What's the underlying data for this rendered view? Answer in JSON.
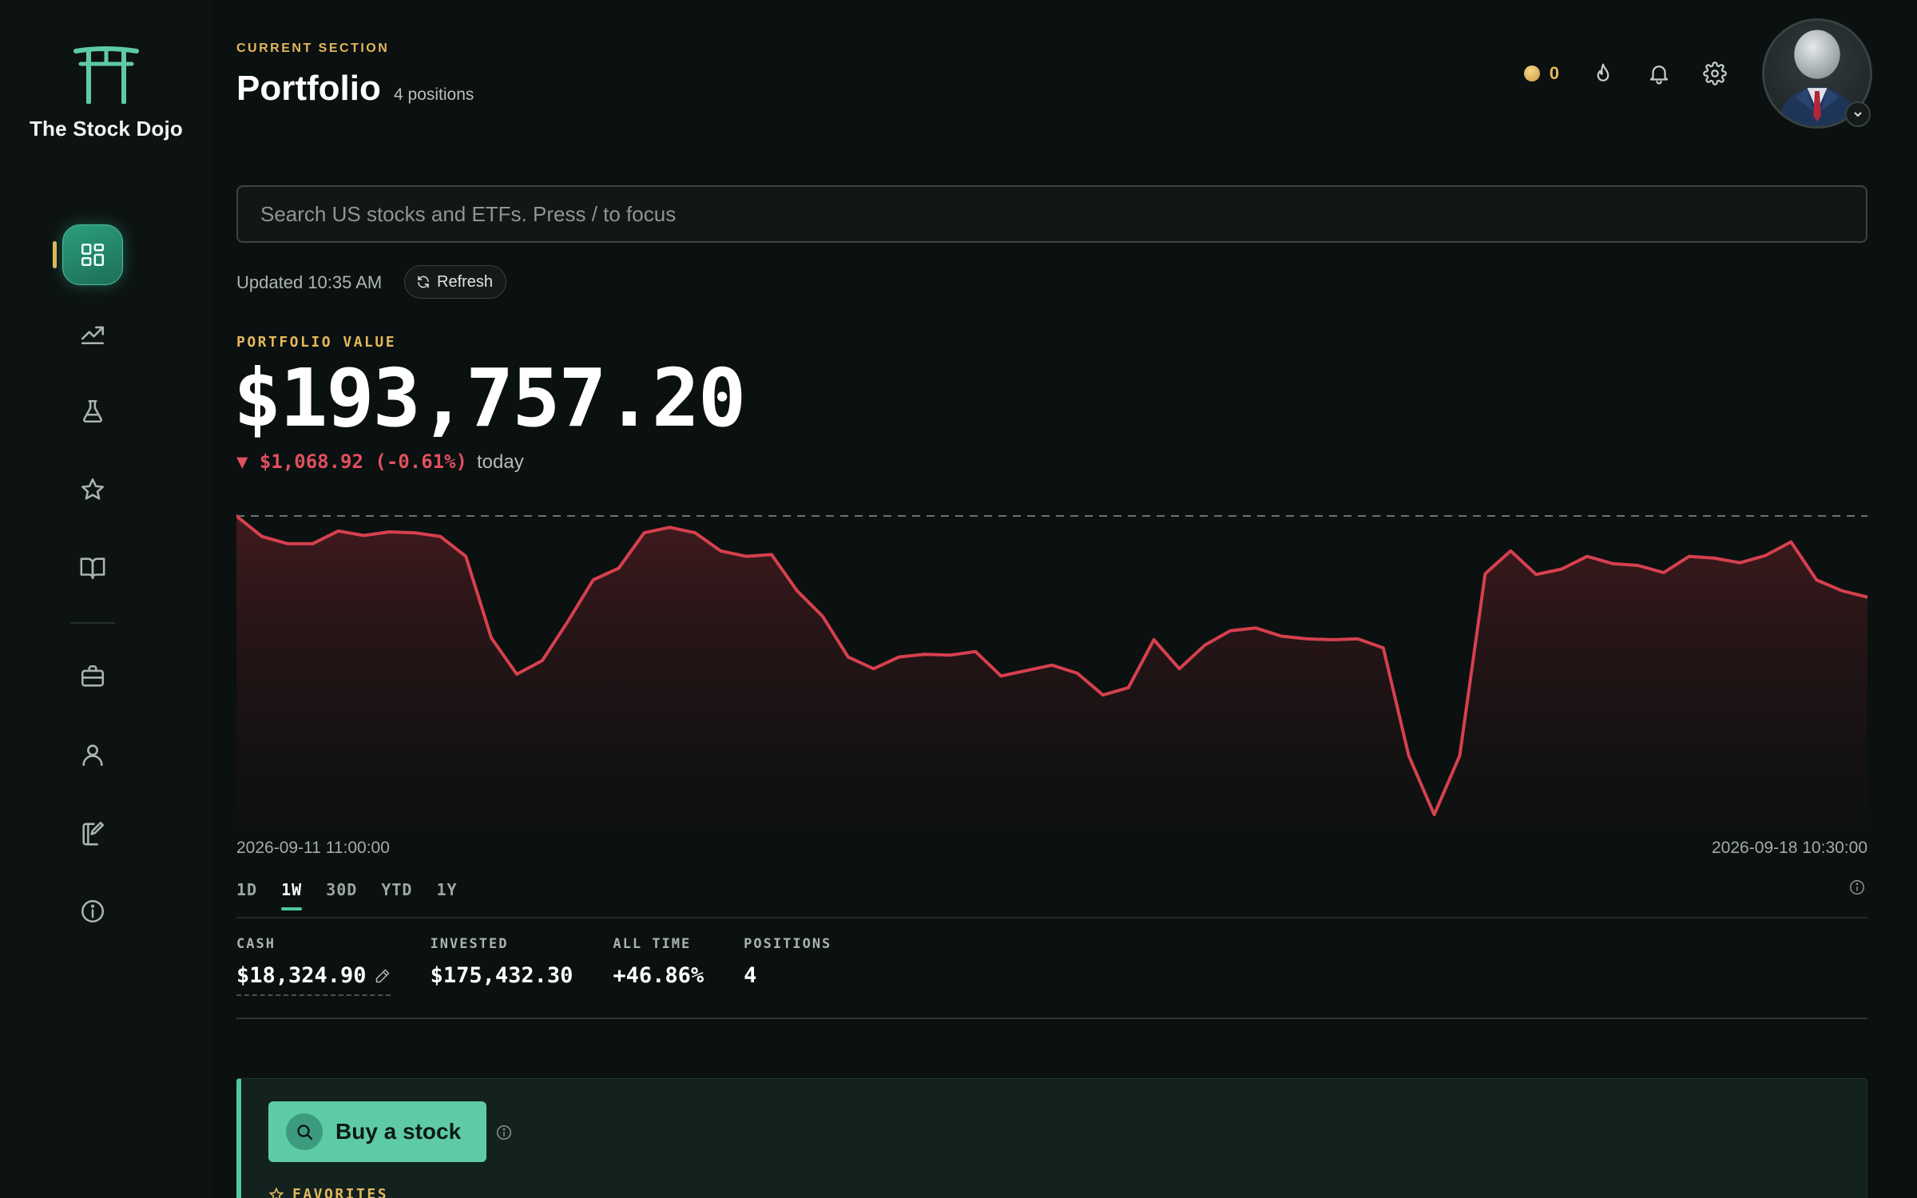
{
  "brand": {
    "name": "The Stock Dojo"
  },
  "header": {
    "section_label": "CURRENT SECTION",
    "title": "Portfolio",
    "subtitle": "4 positions",
    "coin_count": "0"
  },
  "sidebar": {
    "items": [
      {
        "id": "dashboard",
        "icon": "grid-icon",
        "active": true
      },
      {
        "id": "markets",
        "icon": "trending-up-icon"
      },
      {
        "id": "lab",
        "icon": "flask-icon"
      },
      {
        "id": "favorites",
        "icon": "star-icon"
      },
      {
        "id": "learn",
        "icon": "book-icon"
      },
      {
        "id": "portfolio",
        "icon": "briefcase-icon"
      },
      {
        "id": "profile",
        "icon": "user-icon"
      },
      {
        "id": "journal",
        "icon": "notebook-pen-icon"
      },
      {
        "id": "about",
        "icon": "info-icon"
      }
    ]
  },
  "search": {
    "placeholder": "Search US stocks and ETFs. Press / to focus"
  },
  "status": {
    "updated": "Updated 10:35 AM",
    "refresh_label": "Refresh"
  },
  "portfolio": {
    "label": "PORTFOLIO VALUE",
    "value": "$193,757.20",
    "change": "▼ $1,068.92 (-0.61%)",
    "change_suffix": "today"
  },
  "chart_data": {
    "type": "area",
    "x_start_label": "2026-09-11 11:00:00",
    "x_end_label": "2026-09-18 10:30:00",
    "baseline": 194826.12,
    "color": "#d6404e",
    "values": [
      194826,
      194600,
      194520,
      194520,
      194660,
      194610,
      194650,
      194640,
      194600,
      194380,
      193480,
      193080,
      193230,
      193660,
      194120,
      194250,
      194640,
      194700,
      194640,
      194440,
      194380,
      194400,
      194000,
      193720,
      193270,
      193140,
      193270,
      193300,
      193290,
      193330,
      193060,
      193120,
      193180,
      193090,
      192850,
      192930,
      193460,
      193140,
      193400,
      193560,
      193590,
      193500,
      193470,
      193460,
      193470,
      193370,
      192180,
      191530,
      192180,
      194190,
      194440,
      194180,
      194240,
      194380,
      194300,
      194280,
      194200,
      194380,
      194360,
      194310,
      194390,
      194540,
      194120,
      194000,
      193930
    ]
  },
  "ranges": [
    {
      "label": "1D"
    },
    {
      "label": "1W",
      "active": true
    },
    {
      "label": "30D"
    },
    {
      "label": "YTD"
    },
    {
      "label": "1Y"
    }
  ],
  "stats": {
    "cash": {
      "label": "CASH",
      "value": "$18,324.90"
    },
    "invested": {
      "label": "INVESTED",
      "value": "$175,432.30"
    },
    "all_time": {
      "label": "ALL TIME",
      "value": "+46.86%"
    },
    "positions": {
      "label": "POSITIONS",
      "value": "4"
    }
  },
  "buy": {
    "label": "Buy a stock",
    "favorites_label": "FAVORITES"
  },
  "colors": {
    "accent": "#4fc7a0",
    "gold": "#e3b85a",
    "negative": "#e0505e"
  }
}
